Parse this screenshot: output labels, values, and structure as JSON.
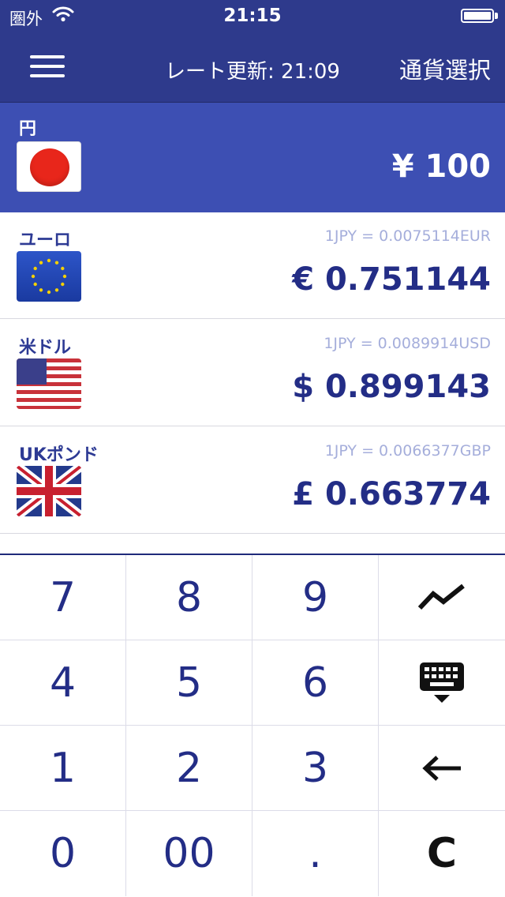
{
  "status": {
    "carrier": "圏外",
    "time": "21:15"
  },
  "nav": {
    "update_label": "レート更新: 21:09",
    "select_label": "通貨選択"
  },
  "base": {
    "name": "円",
    "amount": "¥ 100"
  },
  "currencies": [
    {
      "name": "ユーロ",
      "rate": "1JPY = 0.0075114EUR",
      "amount": "€ 0.751144",
      "flag": "eu-flag"
    },
    {
      "name": "米ドル",
      "rate": "1JPY = 0.0089914USD",
      "amount": "$ 0.899143",
      "flag": "us-flag"
    },
    {
      "name": "UKポンド",
      "rate": "1JPY = 0.0066377GBP",
      "amount": "£ 0.663774",
      "flag": "uk-flag"
    }
  ],
  "keypad": {
    "keys": [
      "7",
      "8",
      "9",
      "4",
      "5",
      "6",
      "1",
      "2",
      "3",
      "0",
      "00",
      ".",
      "C"
    ],
    "icons": [
      "chart-line-icon",
      "keyboard-hide-icon",
      "backspace-arrow-icon"
    ]
  },
  "colors": {
    "header": "#2e3a8c",
    "base_row": "#3d4fb3",
    "amount_text": "#232d86",
    "rate_text": "#a5aedb"
  }
}
